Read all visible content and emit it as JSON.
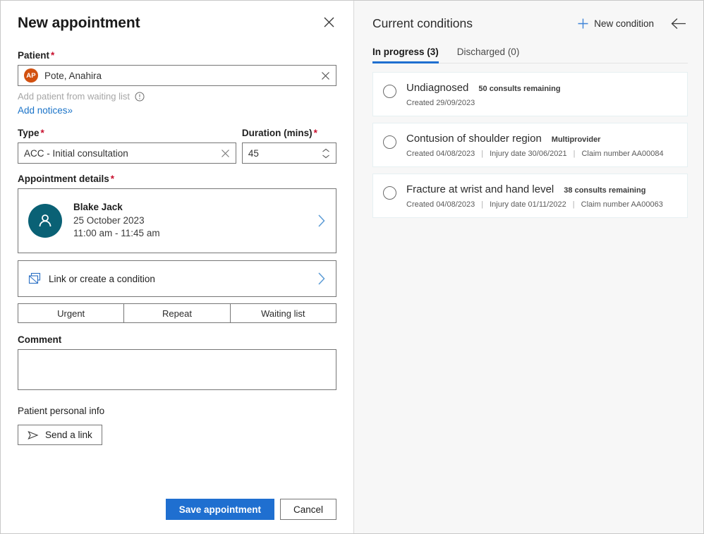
{
  "left": {
    "title": "New appointment",
    "close_icon": "close-icon",
    "patient": {
      "label": "Patient",
      "required": "*",
      "avatar_initials": "AP",
      "avatar_color": "#d2500f",
      "value": "Pote, Anahira",
      "placeholder": "Search patient",
      "clear_icon": "close-icon",
      "waiting_list_text": "Add patient from waiting list",
      "info_icon": "info-icon",
      "add_notices": "Add notices",
      "add_notices_chevrons": "»"
    },
    "type": {
      "label": "Type",
      "required": "*",
      "value": "ACC - Initial consultation",
      "placeholder": "Select type",
      "clear_icon": "close-icon"
    },
    "duration": {
      "label": "Duration (mins)",
      "required": "*",
      "value": "45",
      "placeholder": "0"
    },
    "appointment_details": {
      "label": "Appointment details",
      "required": "*",
      "provider": "Blake Jack",
      "date": "25 October 2023",
      "time": "11:00 am - 11:45 am",
      "avatar_color": "#0a6175",
      "chevron_icon": "chevron-right-icon"
    },
    "link_condition": {
      "label": "Link or create a condition",
      "icon": "layers-icon",
      "chevron_icon": "chevron-right-icon"
    },
    "flags": [
      "Urgent",
      "Repeat",
      "Waiting list"
    ],
    "comment": {
      "label": "Comment",
      "value": "",
      "placeholder": ""
    },
    "personal_info": {
      "label": "Patient personal info",
      "button_label": "Send a link",
      "icon": "send-icon"
    },
    "save_label": "Save appointment",
    "cancel_label": "Cancel",
    "accent": "#1f6fd0"
  },
  "right": {
    "title": "Current conditions",
    "new_condition_label": "New condition",
    "plus_icon": "plus-icon",
    "back_icon": "arrow-left-icon",
    "tabs": [
      {
        "label": "In progress (3)",
        "active": true
      },
      {
        "label": "Discharged (0)",
        "active": false
      }
    ],
    "conditions": [
      {
        "name": "Undiagnosed",
        "badge": "50 consults remaining",
        "meta": [
          "Created 29/09/2023"
        ]
      },
      {
        "name": "Contusion of shoulder region",
        "badge": "Multiprovider",
        "meta": [
          "Created 04/08/2023",
          "Injury date 30/06/2021",
          "Claim number AA00084"
        ]
      },
      {
        "name": "Fracture at wrist and hand level",
        "badge": "38 consults remaining",
        "meta": [
          "Created 04/08/2023",
          "Injury date 01/11/2022",
          "Claim number AA00063"
        ]
      }
    ]
  }
}
